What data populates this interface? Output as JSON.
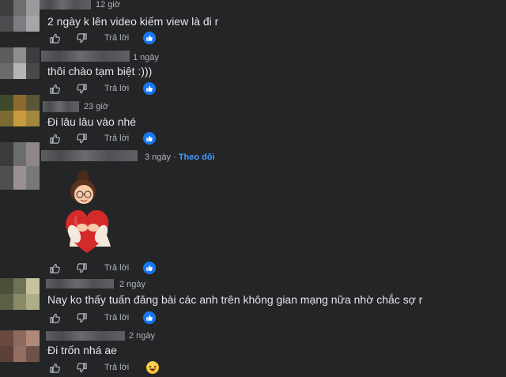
{
  "comments": [
    {
      "time": "12 giờ",
      "text": "2 ngày k lên video kiếm view là đi r",
      "reply": "Trả lời",
      "reaction": "like-reaction-icon",
      "avatar_colors": [
        "#3d3e40",
        "#6d6e70",
        "#9a9b9d",
        "#4b4c4e",
        "#7c7d80",
        "#a5a6a8"
      ]
    },
    {
      "time": "1 ngày",
      "text": "thôi chào tạm biệt :)))",
      "reply": "Trả lời",
      "reaction": "like-reaction-icon",
      "avatar_colors": [
        "#5b5c5e",
        "#8d8e90",
        "#3c3d3f",
        "#6a6b6d",
        "#b4b5b7",
        "#48494b"
      ]
    },
    {
      "time": "23 giờ",
      "text": "Đi lâu lâu vào nhé",
      "reply": "Trả lời",
      "reaction": "like-reaction-icon",
      "avatar_colors": [
        "#3f4a2a",
        "#8c6a2e",
        "#5a5636",
        "#7b6a30",
        "#c79a3e",
        "#a3873d"
      ]
    },
    {
      "time": "3 ngày",
      "follow": "Theo dõi",
      "reply": "Trả lời",
      "reaction": "like-reaction-icon",
      "sticker": "hug-heart-sticker",
      "avatar_colors": [
        "#3a3b3d",
        "#6b6c6e",
        "#8e8688",
        "#4e4f51",
        "#9a8f92",
        "#77787a"
      ]
    },
    {
      "time": "2 ngày",
      "text": "Nay ko thấy tuấn đăng bài các anh trên không gian mạng nữa nhờ chắc sợ r",
      "reply": "Trả lời",
      "reaction": "like-reaction-icon",
      "avatar_colors": [
        "#4a4f3a",
        "#6f7355",
        "#c7c2a0",
        "#5c6046",
        "#8a8a66",
        "#adad8a"
      ]
    },
    {
      "time": "2 ngày",
      "text": "Đi trốn nhá ae",
      "reply": "Trả lời",
      "reaction": "haha-reaction-icon",
      "avatar_colors": [
        "#6a4a40",
        "#8c6a5e",
        "#b08878",
        "#5a4038",
        "#946e60",
        "#6e5248"
      ]
    }
  ]
}
